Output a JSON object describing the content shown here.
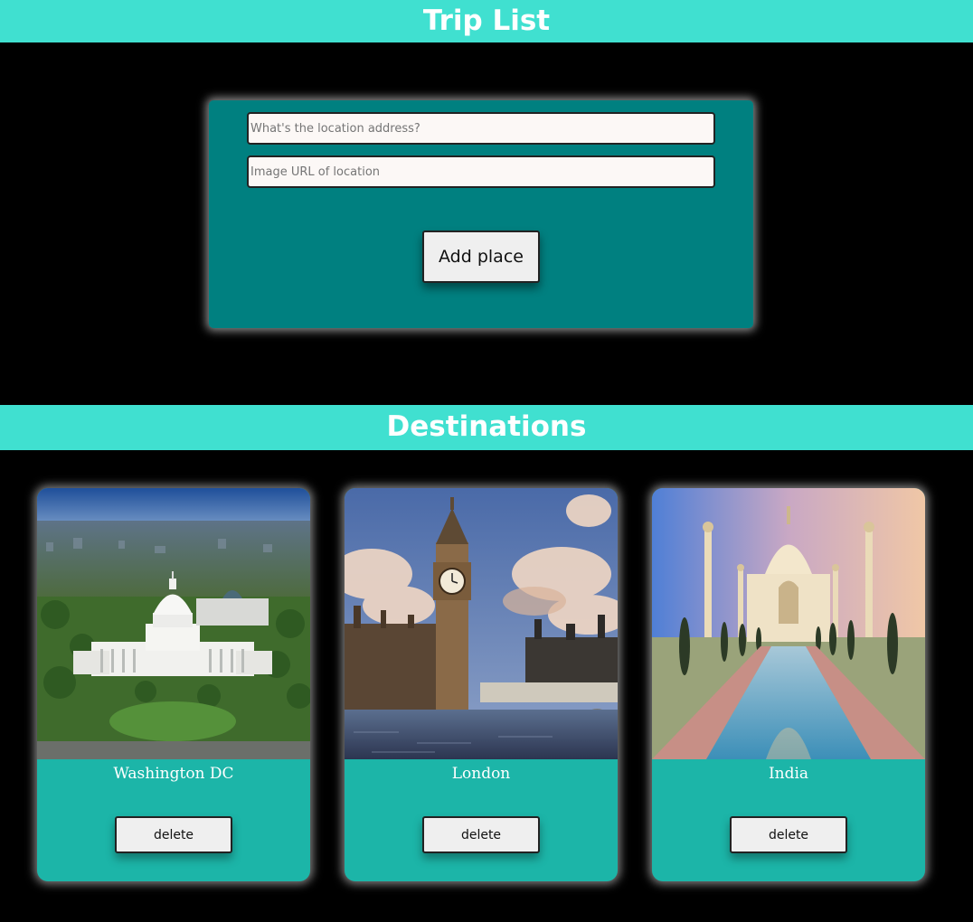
{
  "header": {
    "title": "Trip List"
  },
  "form": {
    "address_placeholder": "What's the location address?",
    "address_value": "",
    "image_url_placeholder": "Image URL of location",
    "image_url_value": "",
    "add_button_label": "Add place"
  },
  "destinations": {
    "title": "Destinations",
    "cards": [
      {
        "name": "Washington DC",
        "image": "capitol-building-photo",
        "delete_label": "delete"
      },
      {
        "name": "London",
        "image": "big-ben-photo",
        "delete_label": "delete"
      },
      {
        "name": "India",
        "image": "taj-mahal-photo",
        "delete_label": "delete"
      }
    ]
  },
  "colors": {
    "banner": "#40e0d0",
    "form_panel": "#008080",
    "card": "#1cb5a8",
    "background": "#000000"
  }
}
